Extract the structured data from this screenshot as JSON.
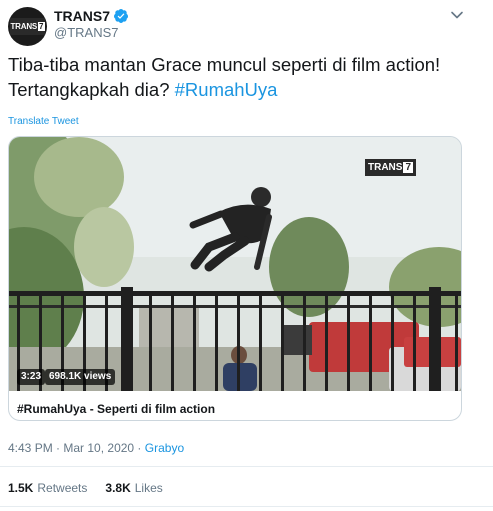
{
  "account": {
    "display_name": "TRANS7",
    "handle": "@TRANS7",
    "avatar_logo_text": "TRANS",
    "avatar_logo_number": "7",
    "verified": true
  },
  "tweet": {
    "text_line1": "Tiba-tiba mantan Grace muncul seperti di film action!",
    "text_line2_plain": "Tertangkapkah dia? ",
    "hashtag": "#RumahUya",
    "translate_label": "Translate Tweet"
  },
  "media": {
    "logo_text": "TRANS",
    "logo_number": "7",
    "duration": "3:23",
    "views": "698.1K views",
    "card_title": "#RumahUya - Seperti di film action"
  },
  "meta": {
    "time": "4:43 PM",
    "separator": " · ",
    "date": "Mar 10, 2020",
    "source": "Grabyo"
  },
  "stats": {
    "retweets_count": "1.5K",
    "retweets_label": "Retweets",
    "likes_count": "3.8K",
    "likes_label": "Likes"
  },
  "colors": {
    "accent": "#1b95e0",
    "secondary_text": "#657786"
  }
}
